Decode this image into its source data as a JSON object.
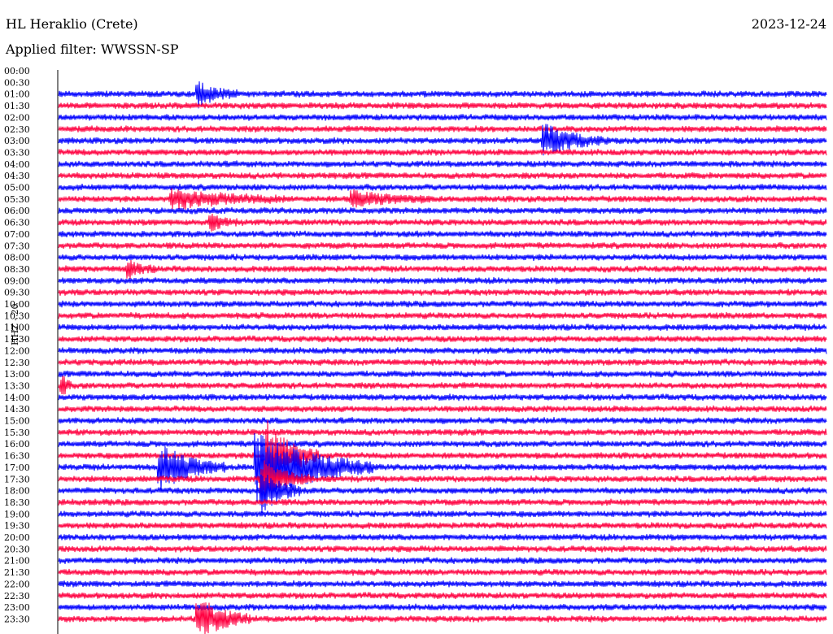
{
  "header": {
    "station": "HL Heraklio (Crete)",
    "date": "2023-12-24",
    "filter": "Applied filter: WWSSN-SP"
  },
  "chart_data": {
    "type": "line",
    "ylabel": "HHZ - 20",
    "categories": [
      "00:00",
      "00:30",
      "01:00",
      "01:30",
      "02:00",
      "02:30",
      "03:00",
      "03:30",
      "04:00",
      "04:30",
      "05:00",
      "05:30",
      "06:00",
      "06:30",
      "07:00",
      "07:30",
      "08:00",
      "08:30",
      "09:00",
      "09:30",
      "10:00",
      "10:30",
      "11:00",
      "11:30",
      "12:00",
      "12:30",
      "13:00",
      "13:30",
      "14:00",
      "14:30",
      "15:00",
      "15:30",
      "16:00",
      "16:30",
      "17:00",
      "17:30",
      "18:00",
      "18:30",
      "19:00",
      "19:30",
      "20:00",
      "20:30",
      "21:00",
      "21:30",
      "22:00",
      "22:30",
      "23:00",
      "23:30"
    ],
    "trace_colors": [
      "#0000ff",
      "#ff0040"
    ],
    "x_minutes_range": [
      0,
      30
    ],
    "events": [
      {
        "row": "01:00",
        "minute": 5.5,
        "amplitude": 2.0,
        "duration_min": 1.5
      },
      {
        "row": "03:00",
        "minute": 19.0,
        "amplitude": 2.5,
        "duration_min": 2.5
      },
      {
        "row": "05:30",
        "minute": 4.5,
        "amplitude": 1.6,
        "duration_min": 4.5
      },
      {
        "row": "05:30",
        "minute": 11.5,
        "amplitude": 1.3,
        "duration_min": 3.0
      },
      {
        "row": "06:30",
        "minute": 6.0,
        "amplitude": 1.2,
        "duration_min": 1.0
      },
      {
        "row": "08:30",
        "minute": 2.8,
        "amplitude": 1.2,
        "duration_min": 1.0
      },
      {
        "row": "13:30",
        "minute": 0.2,
        "amplitude": 1.6,
        "duration_min": 0.3
      },
      {
        "row": "16:30",
        "minute": 8.2,
        "amplitude": 6.0,
        "duration_min": 2.0
      },
      {
        "row": "17:00",
        "minute": 4.0,
        "amplitude": 4.0,
        "duration_min": 2.5
      },
      {
        "row": "17:00",
        "minute": 7.8,
        "amplitude": 6.0,
        "duration_min": 4.5
      },
      {
        "row": "17:30",
        "minute": 8.0,
        "amplitude": 3.0,
        "duration_min": 2.0
      },
      {
        "row": "18:00",
        "minute": 8.0,
        "amplitude": 3.5,
        "duration_min": 1.5
      },
      {
        "row": "23:30",
        "minute": 5.5,
        "amplitude": 3.5,
        "duration_min": 2.0
      }
    ]
  }
}
